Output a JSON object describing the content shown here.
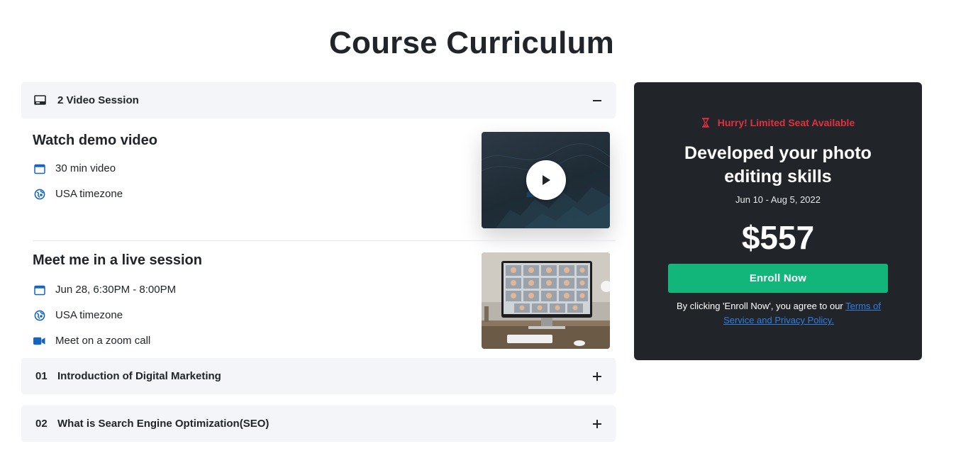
{
  "page": {
    "title": "Course Curriculum"
  },
  "curriculum": {
    "open_section": {
      "title": "2 Video Session",
      "toggle": "collapse"
    },
    "sessions": [
      {
        "title": "Watch demo video",
        "meta": [
          {
            "icon": "calendar-icon",
            "text": "30 min video"
          },
          {
            "icon": "globe-icon",
            "text": "USA timezone"
          }
        ],
        "thumbnail": "video-thumbnail"
      },
      {
        "title": "Meet me in a live session",
        "meta": [
          {
            "icon": "calendar-icon",
            "text": "Jun 28, 6:30PM - 8:00PM"
          },
          {
            "icon": "globe-icon",
            "text": "USA timezone"
          },
          {
            "icon": "video-camera-icon",
            "text": "Meet on a zoom call"
          }
        ],
        "thumbnail": "zoom-call-image"
      }
    ],
    "collapsed_sections": [
      {
        "number": "01",
        "title": "Introduction of Digital Marketing"
      },
      {
        "number": "02",
        "title": "What is Search Engine Optimization(SEO)"
      }
    ]
  },
  "enroll_card": {
    "hurry": "Hurry! Limited Seat Available",
    "title": "Developed your photo editing skills",
    "dates": "Jun 10 - Aug 5, 2022",
    "price": "$557",
    "button": "Enroll Now",
    "terms_prefix": "By clicking 'Enroll Now', you agree to our ",
    "terms_link": "Terms of Service and Privacy Policy."
  },
  "colors": {
    "accent_green": "#13b67a",
    "hurry_red": "#e0313f",
    "card_bg": "#212529",
    "link_blue": "#2f7fe2",
    "icon_blue": "#1565c0",
    "header_bg": "#f3f5f8"
  }
}
